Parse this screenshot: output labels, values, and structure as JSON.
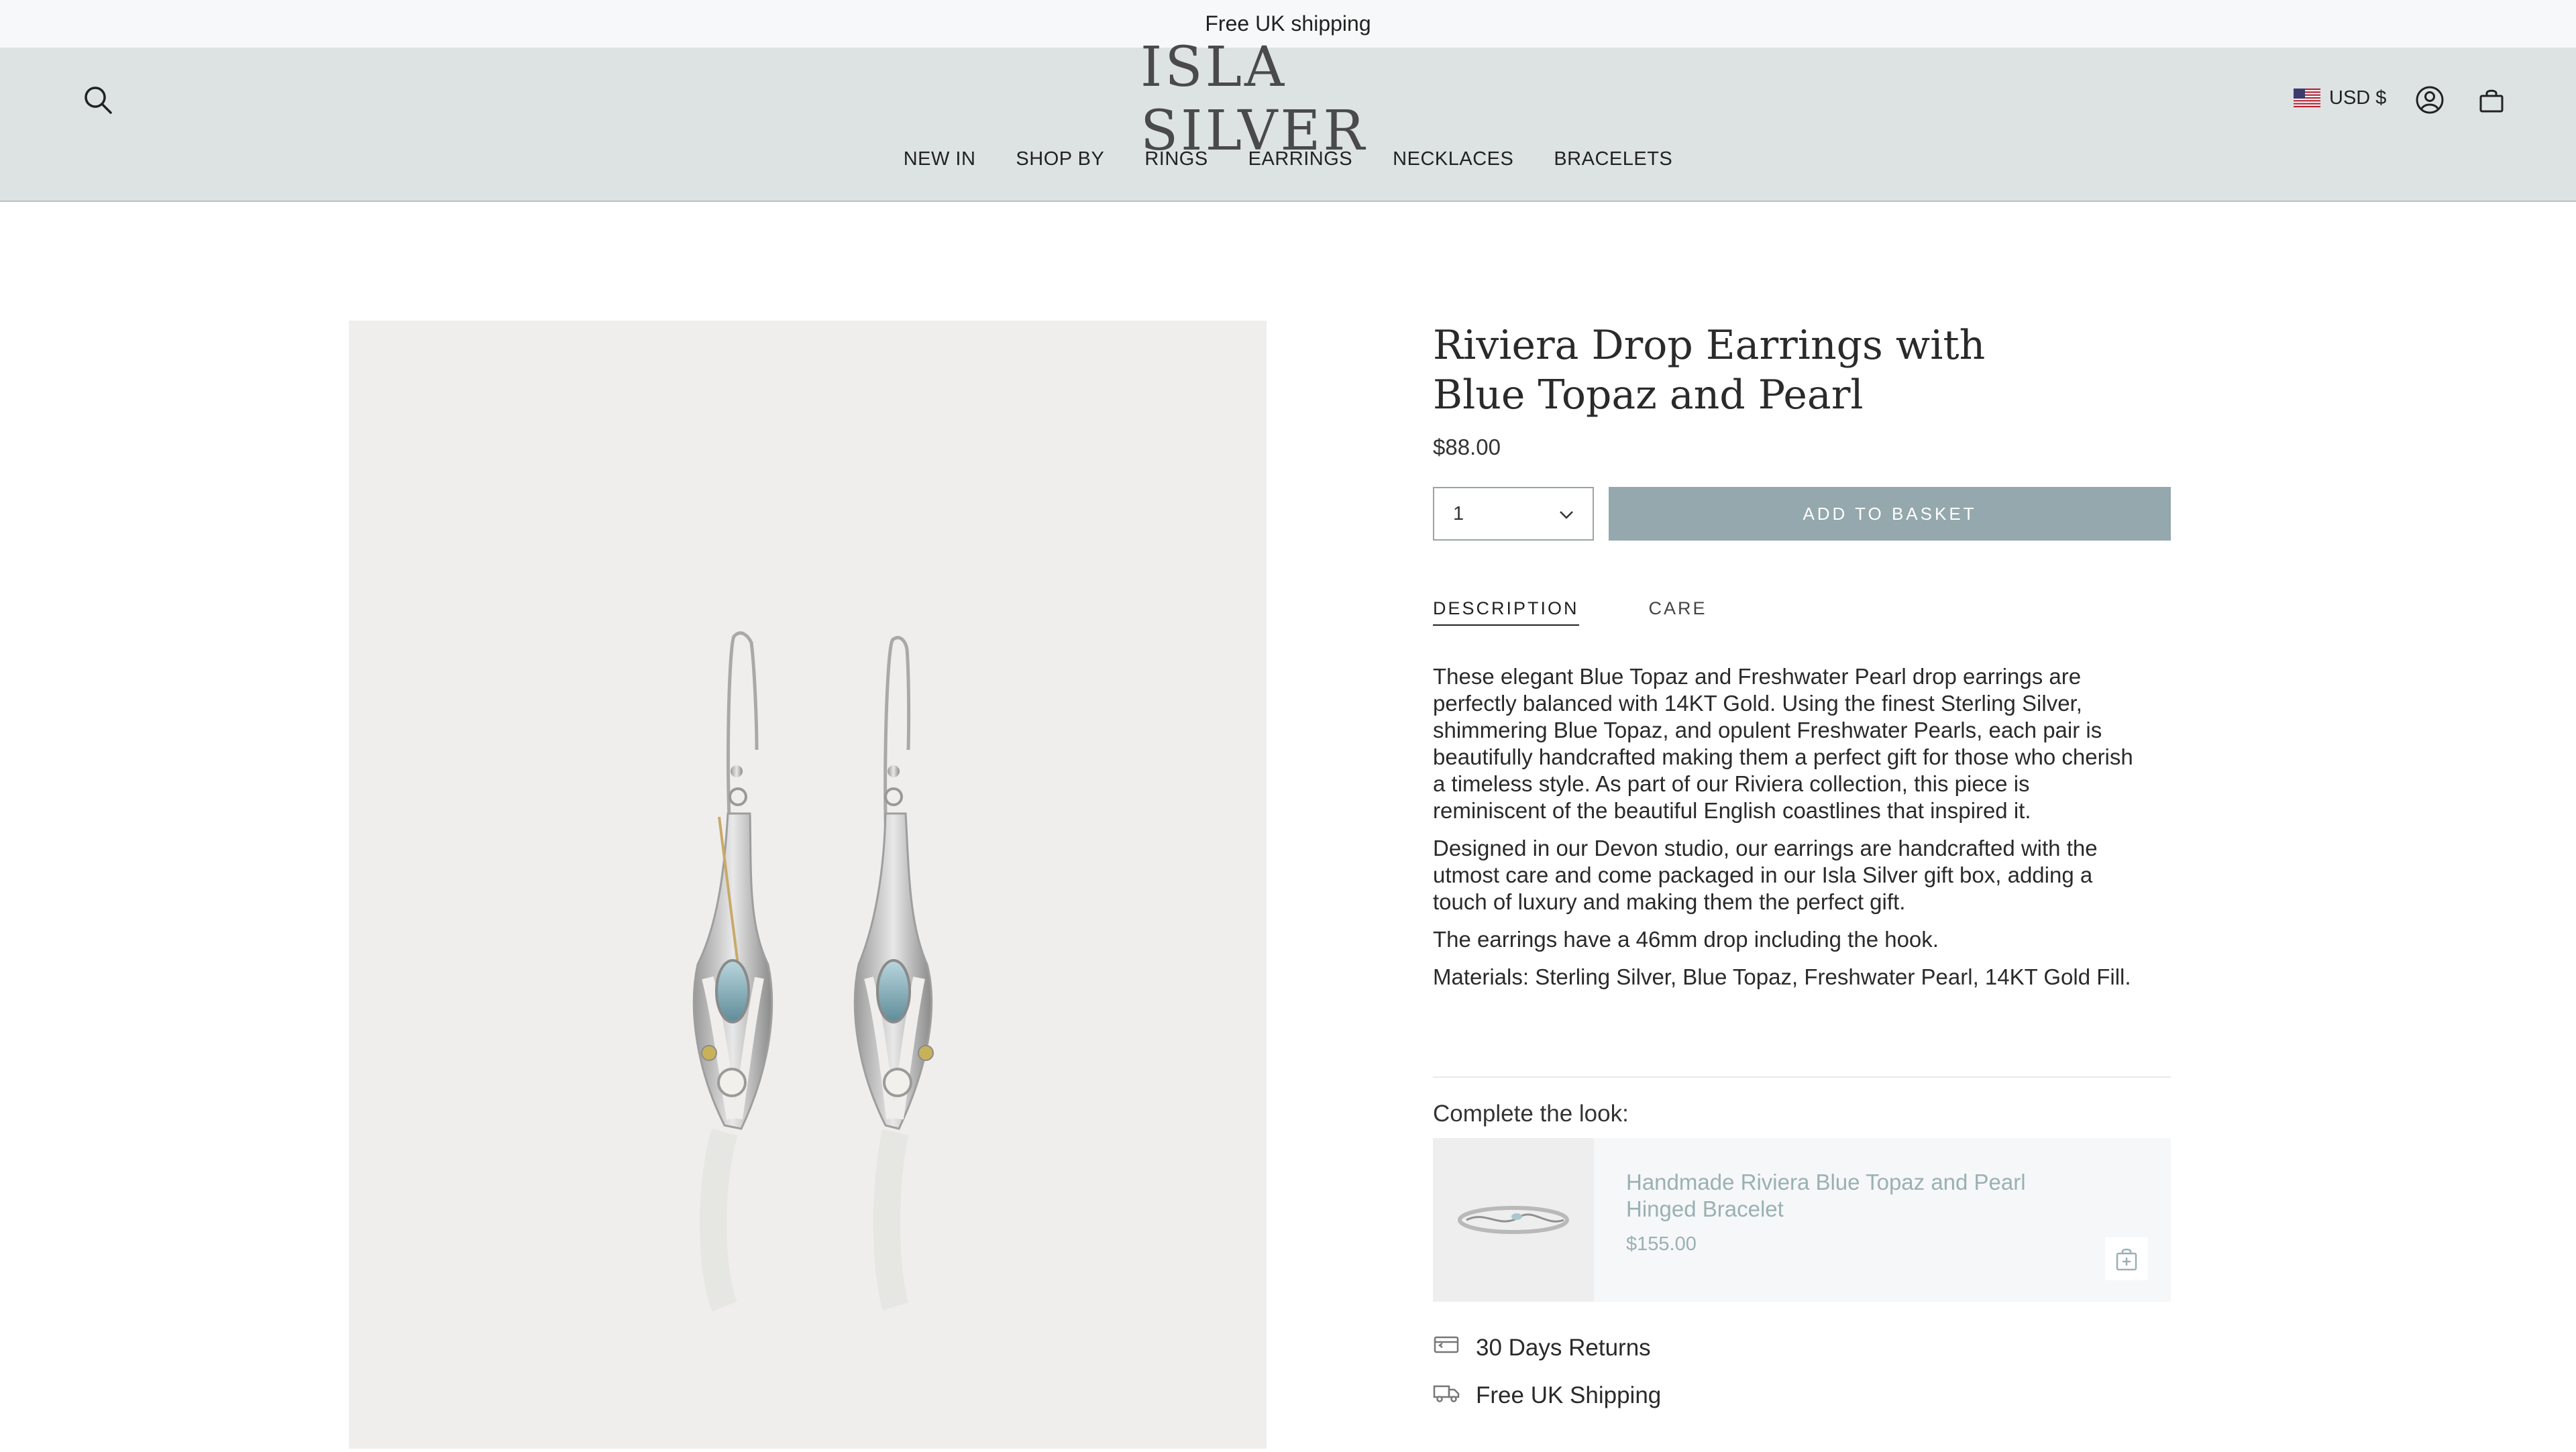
{
  "announcement": {
    "text": "Free UK shipping"
  },
  "header": {
    "logo_text": "ISLA SILVER",
    "currency_label": "USD $",
    "icons": [
      "search-icon",
      "account-icon",
      "cart-icon"
    ]
  },
  "nav": {
    "items": [
      {
        "label": "NEW IN"
      },
      {
        "label": "SHOP BY"
      },
      {
        "label": "RINGS"
      },
      {
        "label": "EARRINGS"
      },
      {
        "label": "NECKLACES"
      },
      {
        "label": "BRACELETS"
      }
    ]
  },
  "product": {
    "title": "Riviera Drop Earrings with Blue Topaz and Pearl",
    "price": "$88.00",
    "quantity": "1",
    "add_to_basket": "ADD TO BASKET",
    "tabs": [
      {
        "label": "DESCRIPTION",
        "active": true
      },
      {
        "label": "CARE",
        "active": false
      }
    ],
    "description": [
      "These elegant Blue Topaz and Freshwater Pearl drop earrings are perfectly balanced with 14KT Gold. Using the finest Sterling Silver, shimmering Blue Topaz, and opulent Freshwater Pearls, each pair is beautifully handcrafted making them a perfect gift for those who cherish a timeless style. As part of our Riviera collection, this piece is reminiscent of the beautiful English coastlines that inspired it.",
      "Designed in our Devon studio, our earrings are handcrafted with the utmost care and come packaged in our Isla Silver gift box, adding a touch of luxury and making them the perfect gift.",
      "The earrings have a 46mm drop including the hook.",
      "Materials: Sterling Silver, Blue Topaz, Freshwater Pearl, 14KT Gold Fill."
    ]
  },
  "complete_the_look": {
    "label": "Complete the look:",
    "item": {
      "name": "Handmade Riviera Blue Topaz and Pearl Hinged Bracelet",
      "price": "$155.00"
    }
  },
  "perks": [
    {
      "label": "30 Days Returns",
      "icon": "returns-icon"
    },
    {
      "label": "Free UK Shipping",
      "icon": "truck-icon"
    }
  ],
  "colors": {
    "header_bg": "#dde3e3",
    "button_bg": "#94a8ad",
    "link_muted": "#9ab0b4"
  }
}
